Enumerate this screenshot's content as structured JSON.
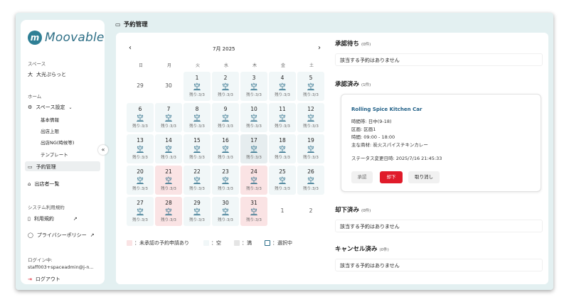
{
  "brand": {
    "name": "Moovable"
  },
  "sidebar": {
    "space_label": "スペース",
    "space_avatar": "大",
    "space_name": "大光ぷらっと",
    "home_label": "ホーム",
    "settings_label": "スペース設定",
    "sub_items": [
      "基本情報",
      "出店上限",
      "出店NG(時候等)",
      "テンプレート"
    ],
    "reservation_label": "予約管理",
    "vendor_label": "出店者一覧",
    "system_label": "システム利用規約",
    "terms_label": "利用規約",
    "privacy_label": "プライバシーポリシー",
    "login_label": "ログイン中:",
    "login_user": "staff003+spaceadmin@j-n...",
    "logout_label": "ログアウト",
    "collapse": "«"
  },
  "page": {
    "title": "予約管理"
  },
  "calendar": {
    "month": "7月 2025",
    "prev": "‹",
    "next": "›",
    "weekdays": [
      "日",
      "月",
      "火",
      "水",
      "木",
      "金",
      "土"
    ],
    "weeks": [
      [
        {
          "day": "29",
          "type": "out"
        },
        {
          "day": "30",
          "type": "out"
        },
        {
          "day": "1",
          "type": "avail",
          "status": "空",
          "remain": "残り:3/3"
        },
        {
          "day": "2",
          "type": "avail",
          "status": "空",
          "remain": "残り:3/3"
        },
        {
          "day": "3",
          "type": "avail",
          "status": "空",
          "remain": "残り:3/3"
        },
        {
          "day": "4",
          "type": "avail",
          "status": "空",
          "remain": "残り:3/3"
        },
        {
          "day": "5",
          "type": "avail",
          "status": "空",
          "remain": "残り:3/3"
        }
      ],
      [
        {
          "day": "6",
          "type": "avail",
          "status": "空",
          "remain": "残り:3/3"
        },
        {
          "day": "7",
          "type": "avail",
          "status": "空",
          "remain": "残り:3/3"
        },
        {
          "day": "8",
          "type": "avail",
          "status": "空",
          "remain": "残り:3/3"
        },
        {
          "day": "9",
          "type": "avail",
          "status": "空",
          "remain": "残り:3/3"
        },
        {
          "day": "10",
          "type": "avail",
          "status": "空",
          "remain": "残り:3/3"
        },
        {
          "day": "11",
          "type": "avail",
          "status": "空",
          "remain": "残り:3/3"
        },
        {
          "day": "12",
          "type": "avail",
          "status": "空",
          "remain": "残り:3/3"
        }
      ],
      [
        {
          "day": "13",
          "type": "avail",
          "status": "空",
          "remain": "残り:3/3"
        },
        {
          "day": "14",
          "type": "avail",
          "status": "空",
          "remain": "残り:3/3"
        },
        {
          "day": "15",
          "type": "avail",
          "status": "空",
          "remain": "残り:3/3"
        },
        {
          "day": "16",
          "type": "avail",
          "status": "空",
          "remain": "残り:3/3"
        },
        {
          "day": "17",
          "type": "today",
          "status": "空",
          "remain": "残り:3/3"
        },
        {
          "day": "18",
          "type": "avail",
          "status": "空",
          "remain": "残り:3/3"
        },
        {
          "day": "19",
          "type": "avail",
          "status": "空",
          "remain": "残り:3/3"
        }
      ],
      [
        {
          "day": "20",
          "type": "avail",
          "status": "空",
          "remain": "残り:3/3"
        },
        {
          "day": "21",
          "type": "pending",
          "status": "空",
          "remain": "残り:3/3"
        },
        {
          "day": "22",
          "type": "avail",
          "status": "空",
          "remain": "残り:3/3"
        },
        {
          "day": "23",
          "type": "avail",
          "status": "空",
          "remain": "残り:3/3"
        },
        {
          "day": "24",
          "type": "pending",
          "status": "空",
          "remain": "残り:3/3"
        },
        {
          "day": "25",
          "type": "avail",
          "status": "空",
          "remain": "残り:3/3"
        },
        {
          "day": "26",
          "type": "avail",
          "status": "空",
          "remain": "残り:3/3"
        }
      ],
      [
        {
          "day": "27",
          "type": "avail",
          "status": "空",
          "remain": "残り:3/3"
        },
        {
          "day": "28",
          "type": "pending",
          "status": "空",
          "remain": "残り:3/3"
        },
        {
          "day": "29",
          "type": "avail",
          "status": "空",
          "remain": "残り:3/3"
        },
        {
          "day": "30",
          "type": "avail",
          "status": "空",
          "remain": "残り:3/3"
        },
        {
          "day": "31",
          "type": "pending",
          "status": "空",
          "remain": "残り:3/3"
        },
        {
          "day": "1",
          "type": "out"
        },
        {
          "day": "2",
          "type": "out"
        }
      ]
    ],
    "legend": [
      {
        "label": "：未承認の予約申請あり",
        "color": "#fae3e4",
        "border": "#fae3e4"
      },
      {
        "label": "：空",
        "color": "#f1f7f8",
        "border": "#f1f7f8"
      },
      {
        "label": "：満",
        "color": "#e5e5e5",
        "border": "#e5e5e5"
      },
      {
        "label": "：選択中",
        "color": "#ffffff",
        "border": "#2b6e89"
      }
    ]
  },
  "sections": {
    "pending": {
      "title": "承認待ち",
      "count": "(0件)",
      "empty": "該当する予約はありません"
    },
    "approved": {
      "title": "承認済み",
      "count": "(1件)",
      "card": {
        "name": "Rolling Spice Kitchen Car",
        "datetime": "時間帯: 日中(9-18)",
        "area": "区画: 区画1",
        "time": "時間: 09:00 - 18:00",
        "product": "主な商材: 炭火スパイスチキンカレー",
        "updated": "ステータス変更日時: 2025/7/16 21:45:33",
        "approve": "承認",
        "reject": "却下",
        "cancel": "取り消し"
      }
    },
    "rejected": {
      "title": "却下済み",
      "count": "(0件)",
      "empty": "該当する予約はありません"
    },
    "cancelled": {
      "title": "キャンセル済み",
      "count": "(0件)",
      "empty": "該当する予約はありません"
    }
  },
  "colors": {
    "accent": "#2b6e89",
    "danger": "#e01b2a",
    "pending": "#fae3e4",
    "available": "#f1f7f8"
  }
}
